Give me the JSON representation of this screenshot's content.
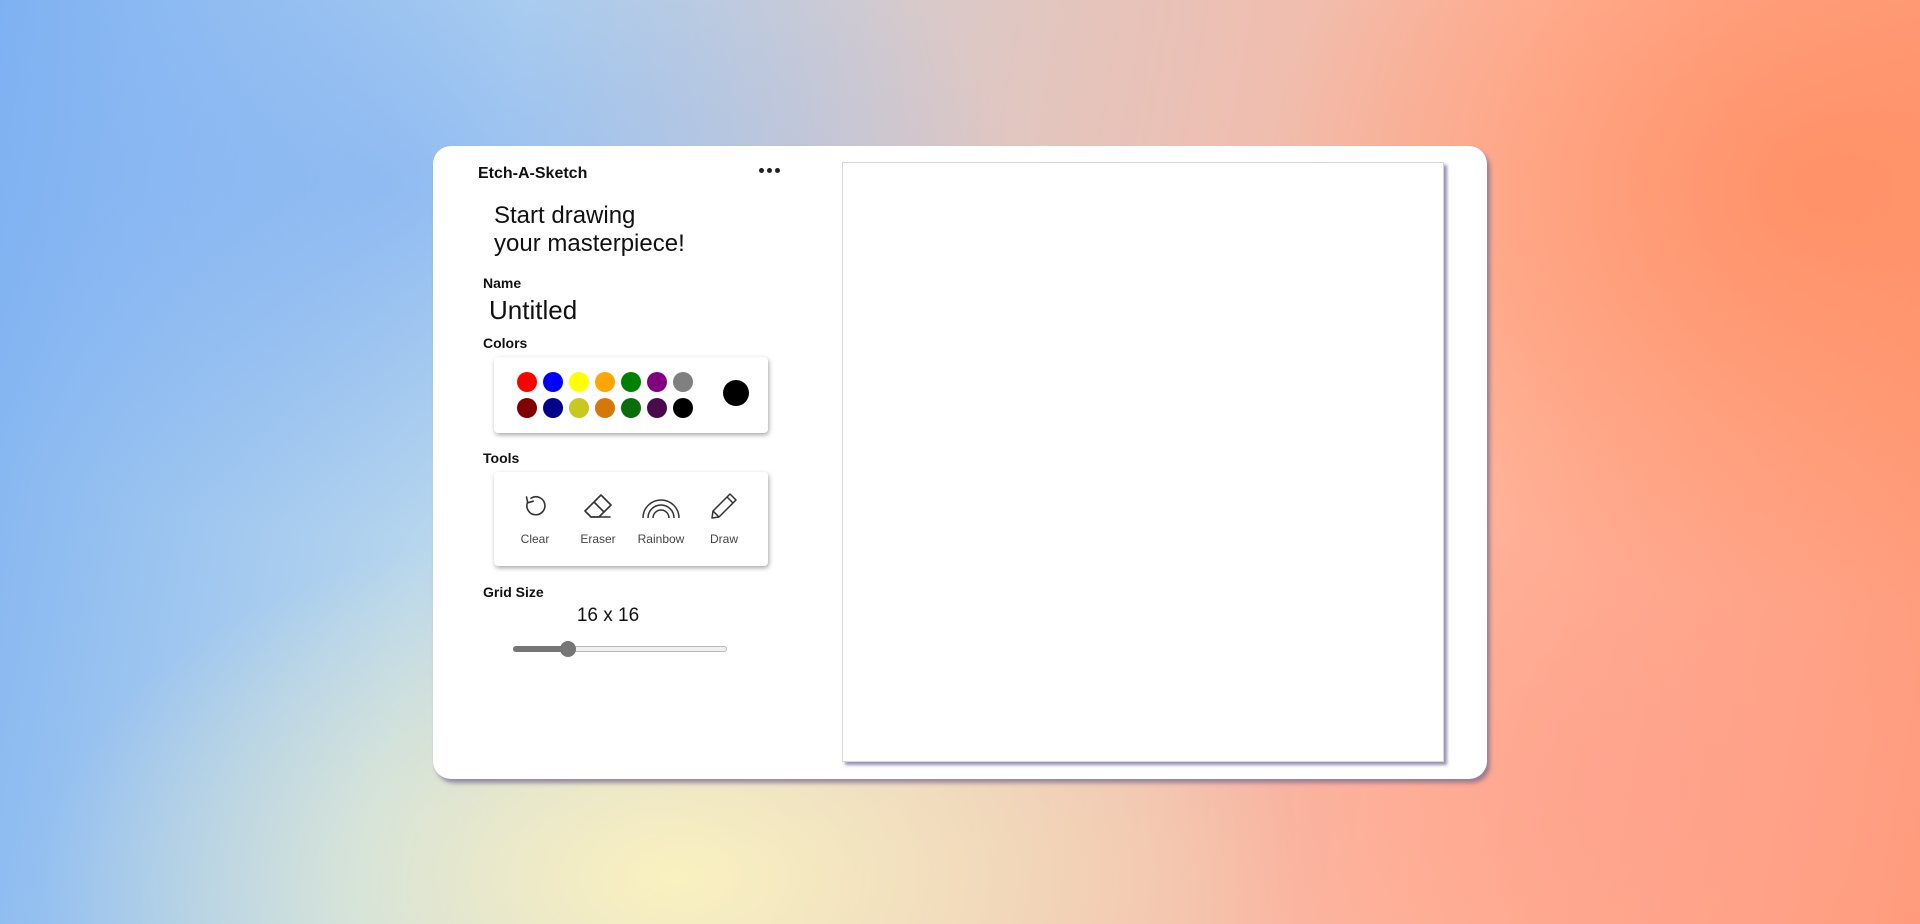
{
  "app": {
    "title": "Etch-A-Sketch",
    "menu_icon": "more-horizontal-icon"
  },
  "headline": {
    "line1": "Start drawing",
    "line2": "your masterpiece!"
  },
  "name": {
    "label": "Name",
    "value": "Untitled"
  },
  "colors": {
    "label": "Colors",
    "swatches": [
      "#ff0000",
      "#0000ff",
      "#ffff00",
      "#ffa500",
      "#008000",
      "#800080",
      "#808080",
      "#800000",
      "#00008b",
      "#c8c81e",
      "#d4780a",
      "#0a6e0a",
      "#4b0a4b",
      "#000000"
    ],
    "current": "#000000"
  },
  "tools": {
    "label": "Tools",
    "items": [
      {
        "label": "Clear",
        "icon": "refresh-icon"
      },
      {
        "label": "Eraser",
        "icon": "eraser-icon"
      },
      {
        "label": "Rainbow",
        "icon": "rainbow-icon"
      },
      {
        "label": "Draw",
        "icon": "pencil-icon"
      }
    ]
  },
  "grid_size": {
    "label": "Grid Size",
    "display": "16 x 16",
    "value": 16,
    "min": 1,
    "max": 64
  }
}
